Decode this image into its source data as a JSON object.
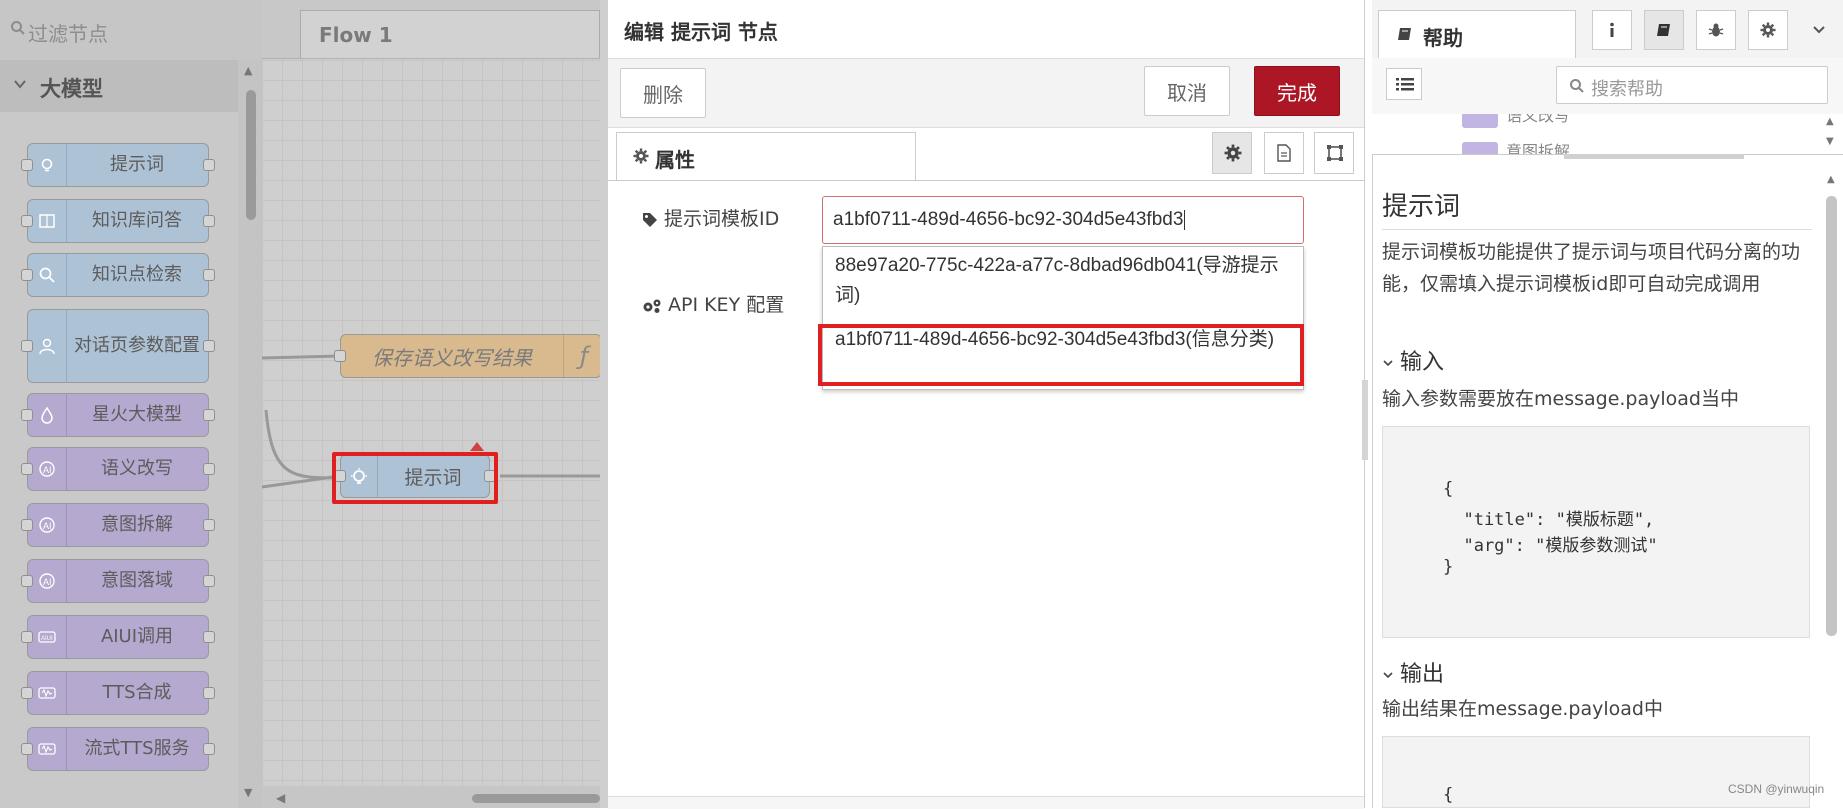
{
  "palette": {
    "search_placeholder": "过滤节点",
    "category_label": "大模型",
    "nodes": [
      {
        "label": "提示词",
        "icon": "lightbulb-icon",
        "color": "blue"
      },
      {
        "label": "知识库问答",
        "icon": "book-icon",
        "color": "blue"
      },
      {
        "label": "知识点检索",
        "icon": "search-icon",
        "color": "blue"
      },
      {
        "label": "对话页参数配置",
        "icon": "user-icon",
        "color": "blue"
      },
      {
        "label": "星火大模型",
        "icon": "drop-icon",
        "color": "purple"
      },
      {
        "label": "语义改写",
        "icon": "ai-icon",
        "color": "purple"
      },
      {
        "label": "意图拆解",
        "icon": "ai-icon",
        "color": "purple"
      },
      {
        "label": "意图落域",
        "icon": "ai-icon",
        "color": "purple"
      },
      {
        "label": "AIUI调用",
        "icon": "aiui-icon",
        "color": "purple"
      },
      {
        "label": "TTS合成",
        "icon": "tts-icon",
        "color": "purple"
      },
      {
        "label": "流式TTS服务",
        "icon": "tts-icon",
        "color": "purple"
      }
    ]
  },
  "workspace": {
    "tab_label": "Flow 1",
    "save_node_label": "保存语义改写结果",
    "save_node_icon": "ƒ",
    "prompt_node_label": "提示词"
  },
  "tray": {
    "title": "编辑 提示词 节点",
    "delete_label": "删除",
    "cancel_label": "取消",
    "done_label": "完成",
    "tab_label": "属性",
    "template_label": "提示词模板ID",
    "template_value": "a1bf0711-489d-4656-bc92-304d5e43fbd3",
    "apikey_label": "API KEY 配置",
    "options": [
      "88e97a20-775c-422a-a77c-8dbad96db041(导游提示词)",
      "a1bf0711-489d-4656-bc92-304d5e43fbd3(信息分类)"
    ]
  },
  "sidebar": {
    "help_tab_label": "帮助",
    "search_placeholder": "搜索帮助",
    "tree_items": [
      "语义改写",
      "意图拆解"
    ],
    "help": {
      "title": "提示词",
      "description": "提示词模板功能提供了提示词与项目代码分离的功能，仅需填入提示词模板id即可自动完成调用",
      "input_heading": "输入",
      "input_text": "输入参数需要放在message.payload当中",
      "code_input": [
        "{",
        "  \"title\": \"模版标题\",",
        "  \"arg\": \"模版参数测试\"",
        "}"
      ],
      "output_heading": "输出",
      "output_text": "输出结果在message.payload中",
      "code_output": [
        "{"
      ]
    }
  },
  "watermark": "CSDN @yinwuqin",
  "colors": {
    "accent": "#ad1625",
    "highlight": "#e02020",
    "node_blue": "#aec2d6",
    "node_purple": "#b5a9cf",
    "function_node": "#d9b98e"
  }
}
